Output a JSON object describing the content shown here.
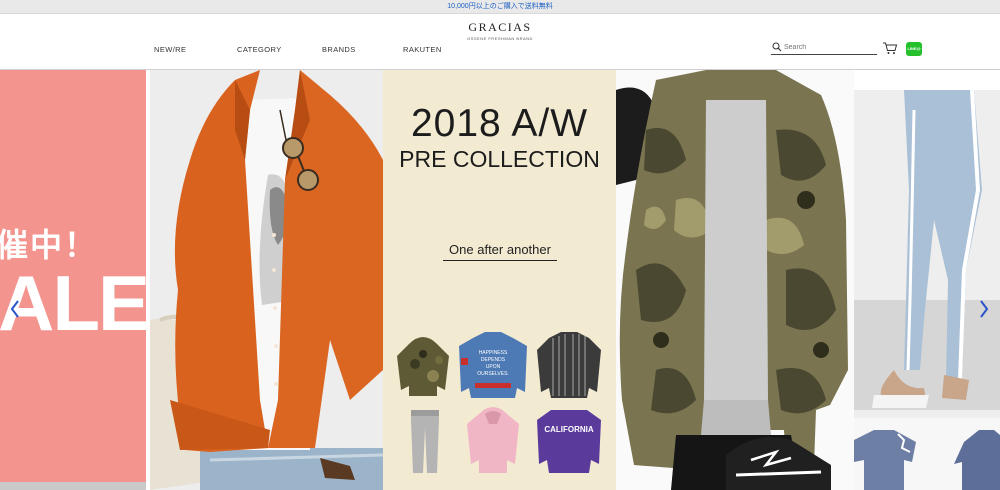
{
  "announcement": "10,000円以上のご購入で送料無料",
  "header": {
    "logo": "GRACIAS",
    "logo_sub": "OSSENE FRESHMAN BRAND",
    "nav": [
      "NEW/RE",
      "CATEGORY",
      "BRANDS",
      "RAKUTEN"
    ],
    "search_placeholder": "Search",
    "line_label": "LINE@"
  },
  "hero": {
    "sale_text_small": "催中！",
    "sale_text_big": "ALE",
    "collection_title": "2018 A/W",
    "collection_subtitle": "PRE COLLECTION",
    "collection_tagline": "One after another",
    "collection_items": [
      "camo-hoodie",
      "denim-jacket-printed",
      "striped-shirt",
      "grey-sweatpants",
      "pink-hoodie",
      "purple-california-sweatshirt"
    ],
    "print_texts": [
      "HAPPINESS",
      "DEPENDS",
      "UPON",
      "OURSELVES.",
      "CALIFORNIA"
    ]
  },
  "colors": {
    "announcement_text": "#1a5fc4",
    "sale_panel": "#f3948f",
    "collection_panel": "#f3ead2",
    "shirt_orange": "#d9621f",
    "line_green": "#25c02b",
    "arrow_blue": "#2a55c8"
  },
  "icons": [
    "search-icon",
    "cart-icon",
    "line-icon",
    "chevron-left-icon",
    "chevron-right-icon"
  ]
}
